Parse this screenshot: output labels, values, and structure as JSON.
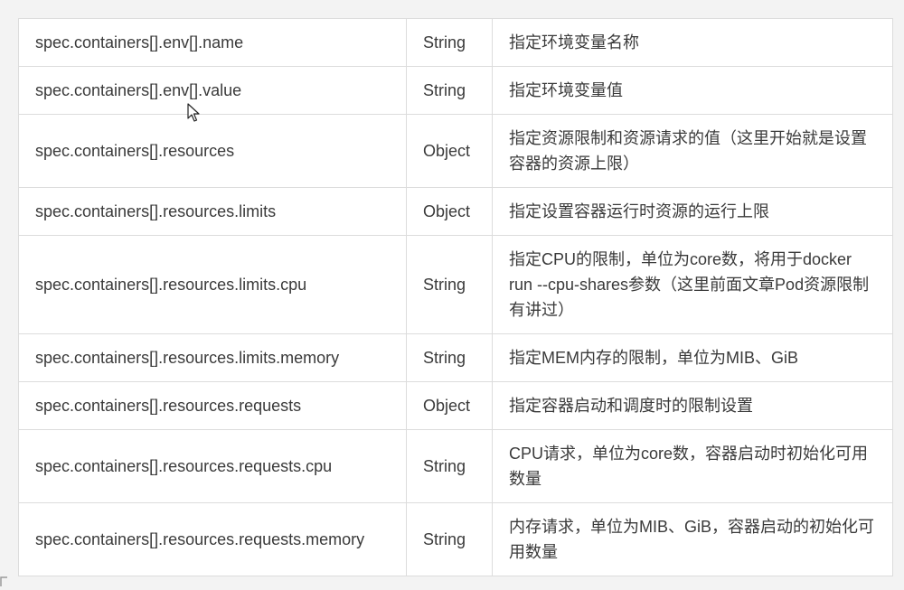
{
  "table": {
    "rows": [
      {
        "param": "spec.containers[].env[].name",
        "type": "String",
        "desc": "指定环境变量名称"
      },
      {
        "param": "spec.containers[].env[].value",
        "type": "String",
        "desc": "指定环境变量值"
      },
      {
        "param": "spec.containers[].resources",
        "type": "Object",
        "desc": "指定资源限制和资源请求的值（这里开始就是设置容器的资源上限）"
      },
      {
        "param": "spec.containers[].resources.limits",
        "type": "Object",
        "desc": "指定设置容器运行时资源的运行上限"
      },
      {
        "param": "spec.containers[].resources.limits.cpu",
        "type": "String",
        "desc": "指定CPU的限制，单位为core数，将用于docker run  --cpu-shares参数（这里前面文章Pod资源限制有讲过）"
      },
      {
        "param": "spec.containers[].resources.limits.memory",
        "type": "String",
        "desc": "指定MEM内存的限制，单位为MIB、GiB"
      },
      {
        "param": "spec.containers[].resources.requests",
        "type": "Object",
        "desc": "指定容器启动和调度时的限制设置"
      },
      {
        "param": "spec.containers[].resources.requests.cpu",
        "type": "String",
        "desc": "CPU请求，单位为core数，容器启动时初始化可用数量"
      },
      {
        "param": "spec.containers[].resources.requests.memory",
        "type": "String",
        "desc": "内存请求，单位为MIB、GiB，容器启动的初始化可用数量"
      }
    ]
  },
  "cursor_icon": "mouse-pointer-icon"
}
